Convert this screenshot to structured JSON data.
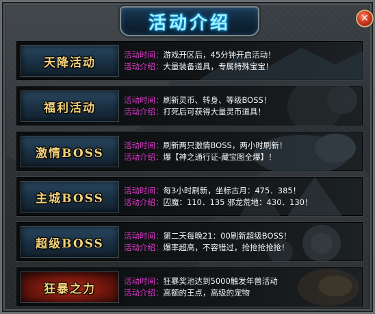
{
  "window": {
    "title": "活动介绍",
    "close_label": "✕"
  },
  "time_label": "活动时间：",
  "intro_label": "活动介绍：",
  "activities": [
    {
      "name": "天降活动",
      "plate": "blue",
      "time": "游戏开区后，45分钟开启活动！",
      "intro": "大量装备道具，专属特殊宝宝！"
    },
    {
      "name": "福利活动",
      "plate": "blue",
      "time": "刷新灵币、转身、等级BOSS！",
      "intro": "打死后可获得大量灵币道具！"
    },
    {
      "name": "激情BOSS",
      "plate": "blue",
      "time": "刷新两只激情BOSS，两小时刷新！",
      "intro": "爆【神之通行证-藏宝图全爆】！"
    },
    {
      "name": "主城BOSS",
      "plate": "blue",
      "time": "每3小时刷新，坐标古月：475．385！",
      "intro": "囚魔：110．135 邪龙荒地：430．130！"
    },
    {
      "name": "超级BOSS",
      "plate": "blue",
      "time": "第二天每晚21：00刷新超级BOSS！",
      "intro": "爆率超高，不容错过，抢抢抢抢抢！"
    },
    {
      "name": "狂暴之力",
      "plate": "red",
      "time": "狂暴奖池达到5000触发年兽活动",
      "intro": "高额的王点，高级的宠物"
    }
  ],
  "colors": {
    "label": "#e23ccf",
    "value": "#f4f4f4",
    "plate_text": "#f3d27a",
    "title_glow": "#9ff3ff"
  }
}
